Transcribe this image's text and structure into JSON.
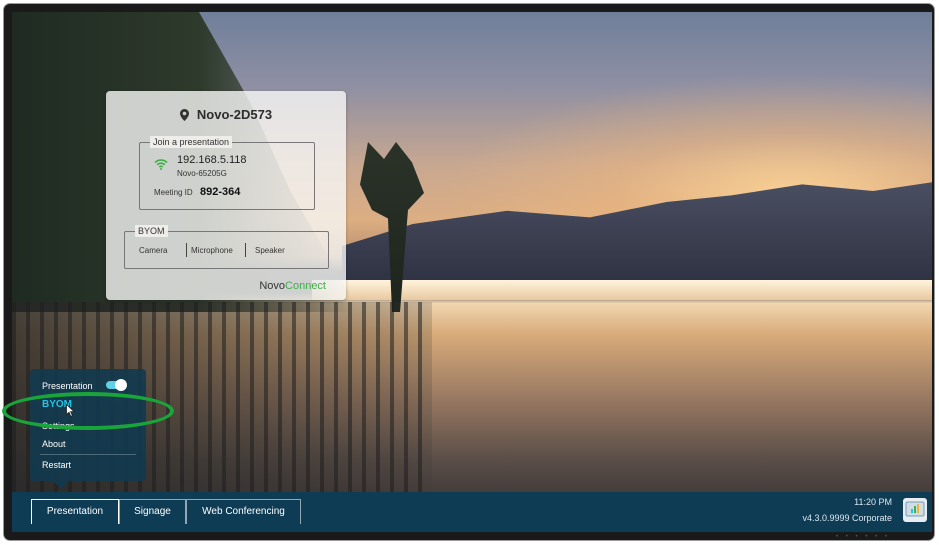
{
  "card": {
    "device_name": "Novo-2D573",
    "join_legend": "Join a presentation",
    "ip_address": "192.168.5.118",
    "ssid": "Novo-65205G",
    "meeting_id_label": "Meeting ID",
    "meeting_id": "892-364",
    "byom_legend": "BYOM",
    "byom_options": [
      "Camera",
      "Microphone",
      "Speaker"
    ],
    "brand_novo": "Novo",
    "brand_connect": "Connect"
  },
  "menu": {
    "items": [
      {
        "label": "Presentation",
        "toggle": true
      },
      {
        "label": "BYOM",
        "active": true
      },
      {
        "label": "Settings"
      },
      {
        "label": "About"
      },
      {
        "label": "Restart"
      }
    ]
  },
  "taskbar": {
    "tabs": [
      {
        "label": "Presentation",
        "active": true
      },
      {
        "label": "Signage"
      },
      {
        "label": "Web Conferencing"
      }
    ],
    "time": "11:20 PM",
    "version": "v4.3.0.9999 Corporate"
  },
  "colors": {
    "accent": "#23c4e8",
    "taskbar": "#0e3c55",
    "brand_green": "#3fae49",
    "highlight": "#1aa53a"
  }
}
